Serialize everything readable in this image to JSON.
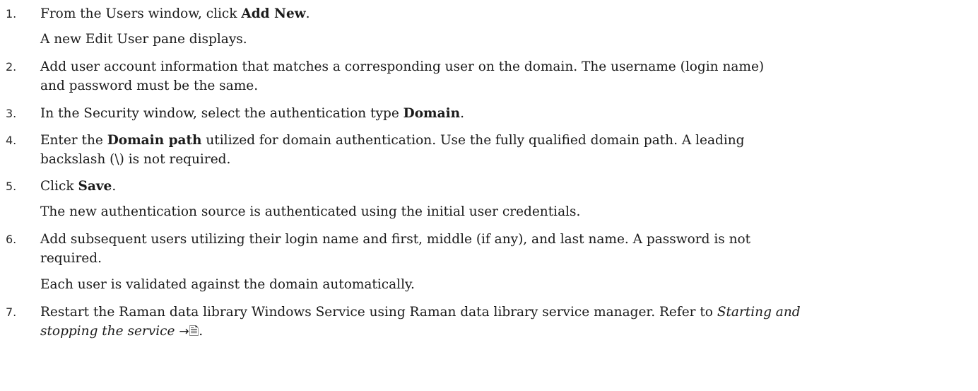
{
  "steps": [
    {
      "number": "1.",
      "pre": "From the Users window, click ",
      "bold": "Add New",
      "post": ".",
      "result": "A new Edit User pane displays."
    },
    {
      "number": "2.",
      "line1": "Add user account information that matches a corresponding user on the domain. The username (login name)",
      "line2": "and password must be the same."
    },
    {
      "number": "3.",
      "pre": "In the Security window, select the authentication type ",
      "bold": "Domain",
      "post": "."
    },
    {
      "number": "4.",
      "pre": "Enter the ",
      "bold": "Domain path",
      "post": " utilized for domain authentication. Use the fully qualified domain path. A leading",
      "line2": "backslash (\\) is not required."
    },
    {
      "number": "5.",
      "pre": "Click ",
      "bold": "Save",
      "post": ".",
      "result": "The new authentication source is authenticated using the initial user credentials."
    },
    {
      "number": "6.",
      "line1": "Add subsequent users utilizing their login name and first, middle (if any), and last name. A password is not",
      "line2": "required.",
      "result": "Each user is validated against the domain automatically."
    },
    {
      "number": "7.",
      "line1": "Restart the Raman data library Windows Service using Raman data library service manager. Refer to ",
      "italic1": "Starting and",
      "italic2": "stopping the service",
      "ref_arrow": "→",
      "ref_icon": "🗎",
      "ref_tail": "."
    }
  ]
}
